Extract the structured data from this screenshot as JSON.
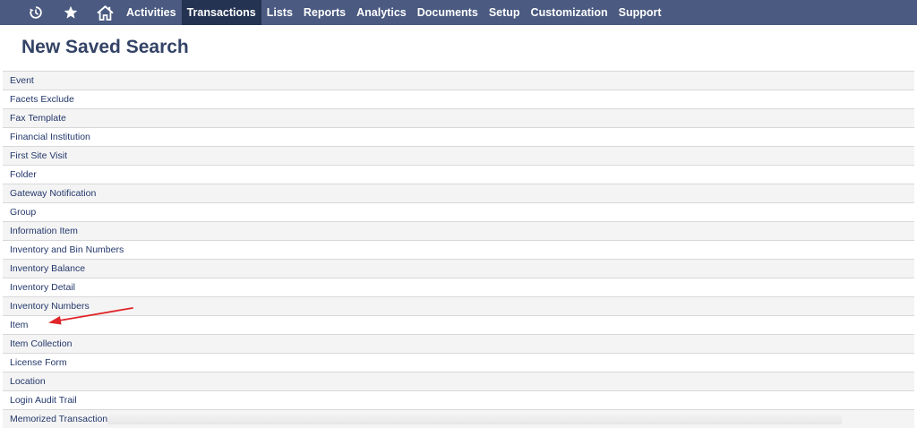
{
  "nav": {
    "icons": [
      {
        "name": "recent-icon"
      },
      {
        "name": "star-icon"
      },
      {
        "name": "home-icon"
      }
    ],
    "items": [
      {
        "label": "Activities",
        "active": false
      },
      {
        "label": "Transactions",
        "active": true
      },
      {
        "label": "Lists",
        "active": false
      },
      {
        "label": "Reports",
        "active": false
      },
      {
        "label": "Analytics",
        "active": false
      },
      {
        "label": "Documents",
        "active": false
      },
      {
        "label": "Setup",
        "active": false
      },
      {
        "label": "Customization",
        "active": false
      },
      {
        "label": "Support",
        "active": false
      }
    ],
    "colors": {
      "bar": "#4a5a80",
      "active": "#243352"
    }
  },
  "page": {
    "title": "New Saved Search"
  },
  "records": [
    "Event",
    "Facets Exclude",
    "Fax Template",
    "Financial Institution",
    "First Site Visit",
    "Folder",
    "Gateway Notification",
    "Group",
    "Information Item",
    "Inventory and Bin Numbers",
    "Inventory Balance",
    "Inventory Detail",
    "Inventory Numbers",
    "Item",
    "Item Collection",
    "License Form",
    "Location",
    "Login Audit Trail",
    "Memorized Transaction"
  ],
  "annotation": {
    "color": "#e0262b"
  }
}
